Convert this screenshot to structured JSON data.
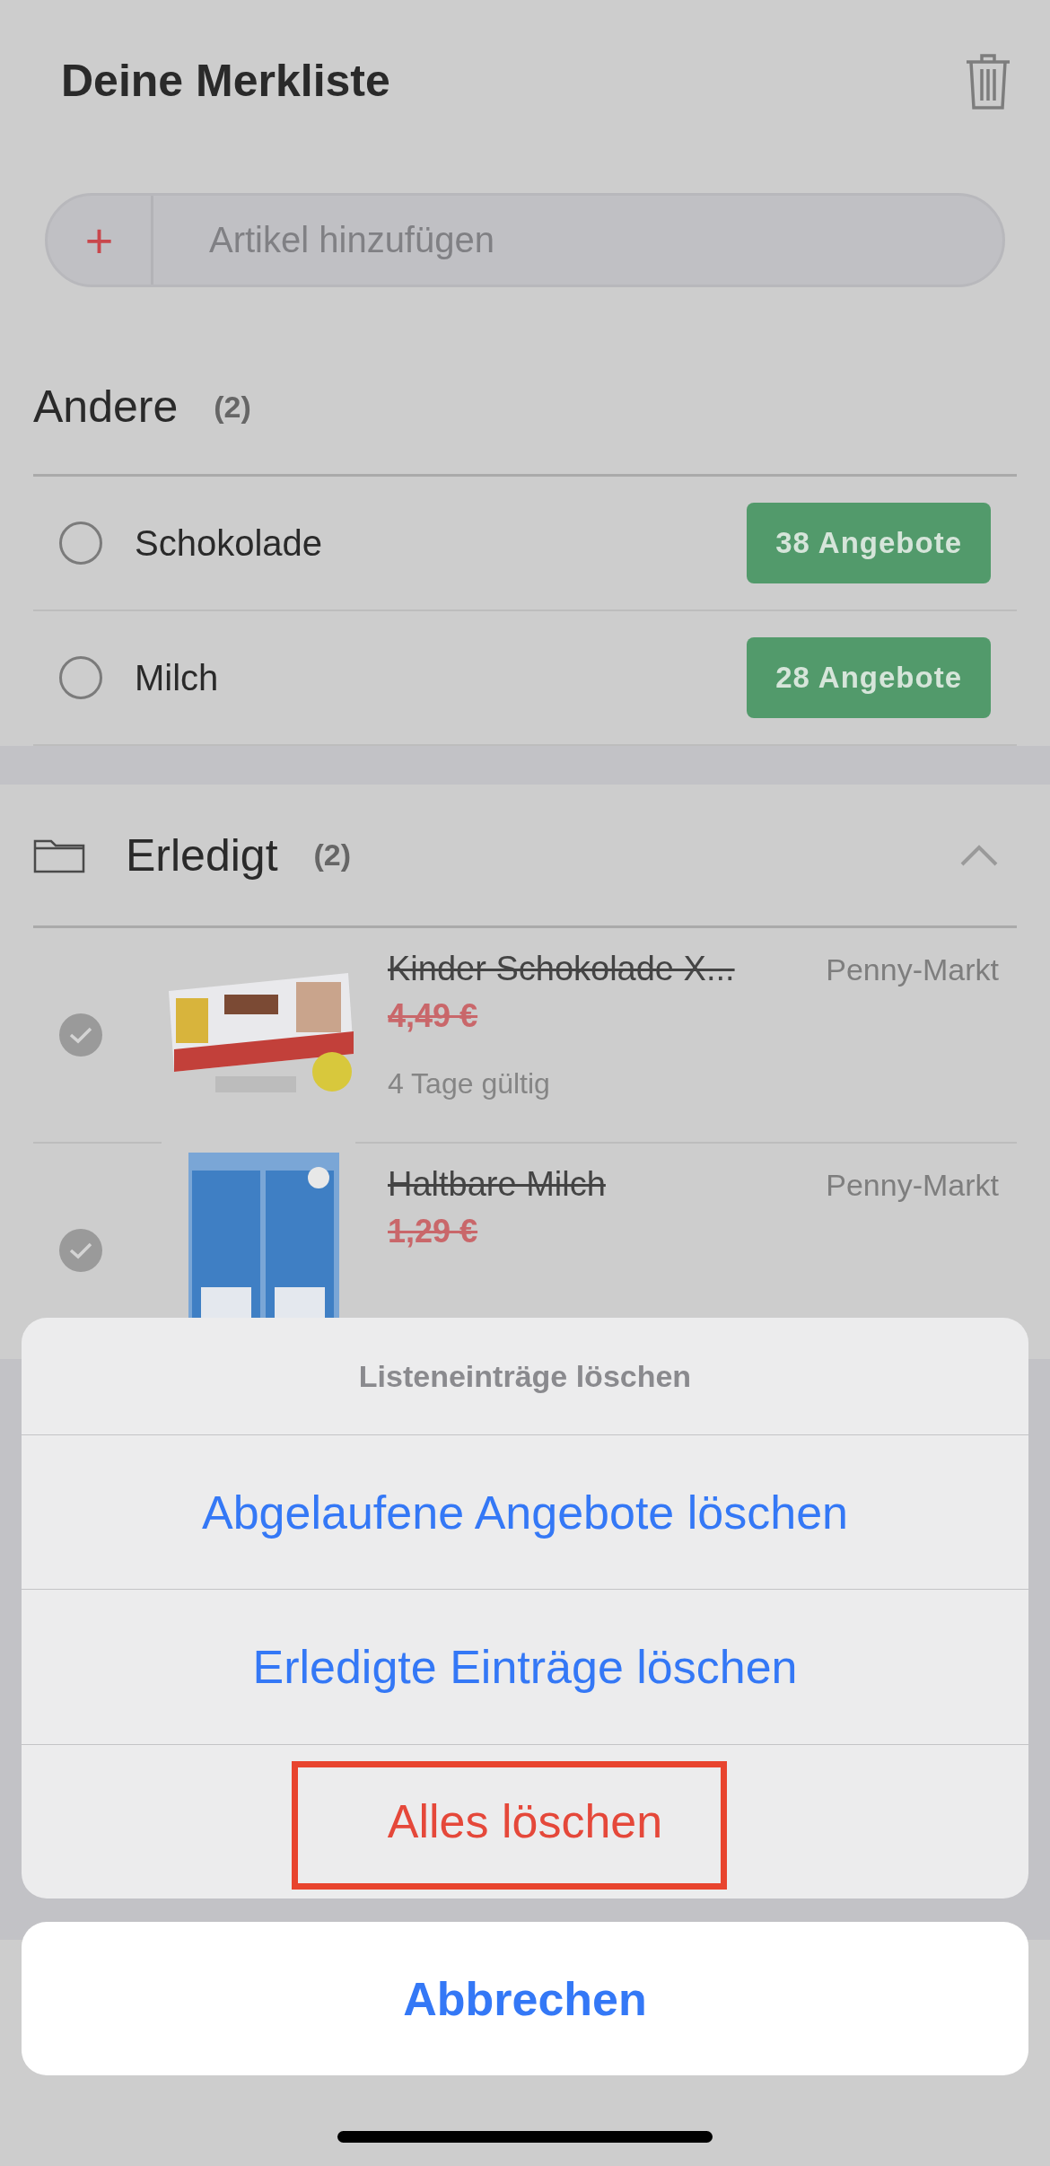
{
  "header": {
    "title": "Deine Merkliste"
  },
  "add_field": {
    "button": "+",
    "placeholder": "Artikel hinzufügen"
  },
  "open_section": {
    "title": "Andere",
    "count": "(2)",
    "items": [
      {
        "name": "Schokolade",
        "checked": false,
        "offers": "38 Angebote"
      },
      {
        "name": "Milch",
        "checked": false,
        "offers": "28 Angebote"
      }
    ]
  },
  "done_section": {
    "title": "Erledigt",
    "count": "(2)",
    "expanded": true,
    "items": [
      {
        "name": "Kinder Schokolade X...",
        "checked": true,
        "store": "Penny-Markt",
        "price": "4,49 €",
        "validity": "4 Tage gültig"
      },
      {
        "name": "Haltbare Milch",
        "checked": true,
        "store": "Penny-Markt",
        "price": "1,29 €"
      }
    ]
  },
  "action_sheet": {
    "title": "Listeneinträge löschen",
    "actions": [
      {
        "label": "Abgelaufene Angebote löschen",
        "kind": "default",
        "highlighted": false
      },
      {
        "label": "Erledigte Einträge löschen",
        "kind": "default",
        "highlighted": false
      },
      {
        "label": "Alles löschen",
        "kind": "destructive",
        "highlighted": true
      }
    ],
    "cancel": "Abbrechen"
  }
}
